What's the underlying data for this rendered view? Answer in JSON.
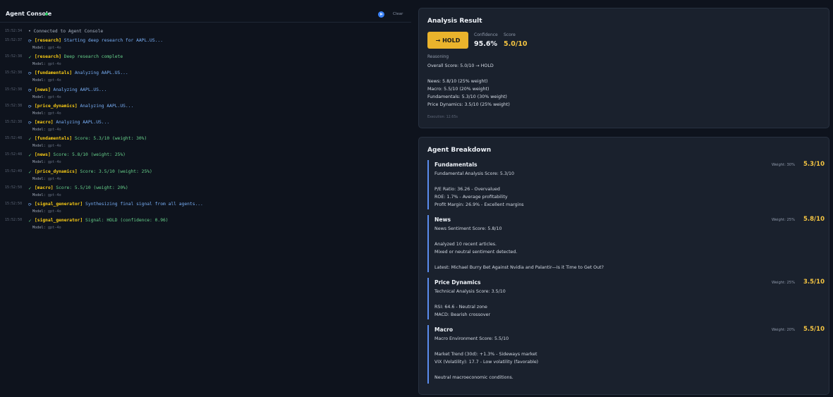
{
  "console": {
    "title": "Agent Console",
    "clear_label": "Clear",
    "connected": {
      "timestamp": "15:52:34",
      "text": "• Connected to Agent Console"
    },
    "entries": [
      {
        "timestamp": "15:52:37",
        "icon": "spinner-icon",
        "tag": "[research]",
        "message": "Starting deep research for AAPL.US...",
        "color": "blue",
        "model_label": "Model:",
        "model": "gpt-4o"
      },
      {
        "timestamp": "15:52:38",
        "icon": "check-icon",
        "tag": "[research]",
        "message": "Deep research complete",
        "color": "green",
        "model_label": "Model:",
        "model": "gpt-4o"
      },
      {
        "timestamp": "15:52:38",
        "icon": "spinner-icon",
        "tag": "[fundamentals]",
        "message": "Analyzing AAPL.US...",
        "color": "blue",
        "model_label": "Model:",
        "model": "gpt-4o"
      },
      {
        "timestamp": "15:52:38",
        "icon": "spinner-icon",
        "tag": "[news]",
        "message": "Analyzing AAPL.US...",
        "color": "blue",
        "model_label": "Model:",
        "model": "gpt-4o"
      },
      {
        "timestamp": "15:52:38",
        "icon": "spinner-icon",
        "tag": "[price_dynamics]",
        "message": "Analyzing AAPL.US...",
        "color": "blue",
        "model_label": "Model:",
        "model": "gpt-4o"
      },
      {
        "timestamp": "15:52:38",
        "icon": "spinner-icon",
        "tag": "[macro]",
        "message": "Analyzing AAPL.US...",
        "color": "blue",
        "model_label": "Model:",
        "model": "gpt-4o"
      },
      {
        "timestamp": "15:52:48",
        "icon": "check-icon",
        "tag": "[fundamentals]",
        "message": "Score: 5.3/10 (weight: 30%)",
        "color": "green",
        "model_label": "Model:",
        "model": "gpt-4o"
      },
      {
        "timestamp": "15:52:48",
        "icon": "check-icon",
        "tag": "[news]",
        "message": "Score: 5.8/10 (weight: 25%)",
        "color": "green",
        "model_label": "Model:",
        "model": "gpt-4o"
      },
      {
        "timestamp": "15:52:49",
        "icon": "check-icon",
        "tag": "[price_dynamics]",
        "message": "Score: 3.5/10 (weight: 25%)",
        "color": "green",
        "model_label": "Model:",
        "model": "gpt-4o"
      },
      {
        "timestamp": "15:52:50",
        "icon": "check-icon",
        "tag": "[macro]",
        "message": "Score: 5.5/10 (weight: 20%)",
        "color": "green",
        "model_label": "Model:",
        "model": "gpt-4o"
      },
      {
        "timestamp": "15:52:50",
        "icon": "spinner-icon",
        "tag": "[signal_generator]",
        "message": "Synthesizing final signal from all agents...",
        "color": "blue",
        "model_label": "Model:",
        "model": "gpt-4o"
      },
      {
        "timestamp": "15:52:50",
        "icon": "check-icon",
        "tag": "[signal_generator]",
        "message": "Signal: HOLD (confidence: 0.96)",
        "color": "green",
        "model_label": "Model:",
        "model": "gpt-4o"
      }
    ]
  },
  "analysis": {
    "title": "Analysis Result",
    "signal_label": "→ HOLD",
    "confidence_label": "Confidence",
    "confidence_value": "95.6%",
    "score_label": "Score",
    "score_value": "5.0/10",
    "reasoning_label": "Reasoning",
    "reasoning_lines": [
      "Overall Score: 5.0/10 → HOLD",
      "",
      "News: 5.8/10 (25% weight)",
      "Macro: 5.5/10 (20% weight)",
      "Fundamentals: 5.3/10 (30% weight)",
      "Price Dynamics: 3.5/10 (25% weight)"
    ],
    "execution_time": "Execution: 12.65s"
  },
  "breakdown": {
    "title": "Agent Breakdown",
    "agents": [
      {
        "name": "Fundamentals",
        "weight": "Weight: 30%",
        "score": "5.3/10",
        "lines": [
          "Fundamental Analysis Score: 5.3/10",
          "",
          "P/E Ratio: 36.26 - Overvalued",
          "ROE: 1.7% - Average profitability",
          "Profit Margin: 26.9% - Excellent margins"
        ]
      },
      {
        "name": "News",
        "weight": "Weight: 25%",
        "score": "5.8/10",
        "lines": [
          "News Sentiment Score: 5.8/10",
          "",
          "Analyzed 10 recent articles.",
          "Mixed or neutral sentiment detected.",
          "",
          "Latest: Michael Burry Bet Against Nvidia and Palantir—Is it Time to Get Out?"
        ]
      },
      {
        "name": "Price Dynamics",
        "weight": "Weight: 25%",
        "score": "3.5/10",
        "lines": [
          "Technical Analysis Score: 3.5/10",
          "",
          "RSI: 64.6 - Neutral zone",
          "MACD: Bearish crossover"
        ]
      },
      {
        "name": "Macro",
        "weight": "Weight: 20%",
        "score": "5.5/10",
        "lines": [
          "Macro Environment Score: 5.5/10",
          "",
          "Market Trend (30d): +1.3% - Sideways market",
          "VIX (Volatility): 17.7 - Low volatility (favorable)",
          "",
          "Neutral macroeconomic conditions."
        ]
      }
    ]
  }
}
